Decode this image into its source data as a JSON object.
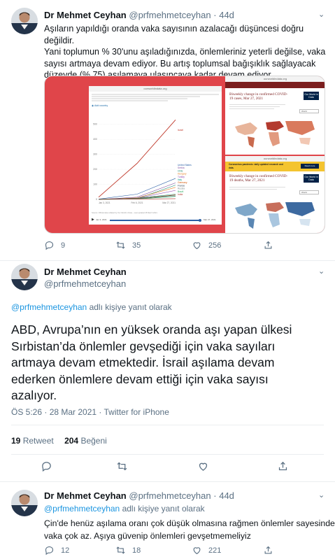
{
  "tweet1": {
    "name": "Dr Mehmet Ceyhan",
    "handle": "@prfmehmetceyhan",
    "dot": "·",
    "time": "44d",
    "lines": [
      "Aşıların yapıldığı oranda vaka sayısının azalacağı düşüncesi doğru değildir.",
      "Yani toplumun % 30'unu aşıladığınızda, önlemleriniz yeterli değilse, vaka",
      "sayısı artmaya devam ediyor. Bu artış toplumsal bağışıklık sağlayacak",
      "düzeyde (% 75) aşılamaya ulaşıncaya kadar devam ediyor."
    ],
    "replies": "9",
    "retweets": "35",
    "likes": "256"
  },
  "media": {
    "site": "ourworldindata.org",
    "add_country": "Add country",
    "chart_tag": "Israel",
    "countries": [
      "United States",
      "Serbia",
      "Turkey",
      "Chile",
      "Hungary",
      "Italy",
      "Germany",
      "France",
      "Russia",
      "Brazil",
      "India"
    ],
    "chart_ticks": [
      "500",
      "400",
      "300",
      "200",
      "100",
      "0"
    ],
    "x_ticks": [
      "Jan 3, 2021",
      "Feb 6, 2021",
      "Mar 27, 2021"
    ],
    "play_start": "Jan 3, 2021",
    "play_end": "Mar 27, 2021",
    "source_note": "Source: Official data collated by Our World in Data – Last updated 28 March 2021",
    "panel2_title": "Biweekly change in confirmed COVID-19 cases, Mar 27, 2021",
    "panel3_banner": "Coronavirus pandemic: daily updated research and data.",
    "panel3_button": "Read more",
    "panel3_title": "Biweekly change in confirmed COVID-19 deaths, Mar 27, 2021",
    "owid_logo": "Our World in Data",
    "select_world": "World"
  },
  "chart_data": {
    "type": "line",
    "title": "",
    "xlabel": "",
    "ylabel": "",
    "x": [
      "Jan 3, 2021",
      "Feb 6, 2021",
      "Mar 27, 2021"
    ],
    "ylim": [
      0,
      550
    ],
    "series": [
      {
        "name": "Israel",
        "values": [
          15,
          240,
          530
        ]
      },
      {
        "name": "United States",
        "values": [
          2,
          35,
          140
        ]
      },
      {
        "name": "Serbia",
        "values": [
          0,
          15,
          110
        ]
      },
      {
        "name": "Chile",
        "values": [
          0,
          5,
          95
        ]
      },
      {
        "name": "Hungary",
        "values": [
          0,
          10,
          80
        ]
      },
      {
        "name": "Turkey",
        "values": [
          0,
          8,
          60
        ]
      },
      {
        "name": "Italy",
        "values": [
          1,
          8,
          35
        ]
      },
      {
        "name": "Germany",
        "values": [
          1,
          6,
          30
        ]
      },
      {
        "name": "France",
        "values": [
          1,
          5,
          28
        ]
      },
      {
        "name": "Russia",
        "values": [
          0,
          4,
          22
        ]
      },
      {
        "name": "Brazil",
        "values": [
          0,
          2,
          20
        ]
      },
      {
        "name": "India",
        "values": [
          0,
          2,
          5
        ]
      }
    ]
  },
  "tweet2": {
    "name": "Dr Mehmet Ceyhan",
    "handle": "@prfmehmetceyhan",
    "reply_to_handle": "@prfmehmetceyhan",
    "reply_to_suffix": " adlı kişiye yanıt olarak",
    "lines": [
      "ABD, Avrupa’nın en yüksek oranda aşı yapan ülkesi",
      "Sırbistan’da önlemler gevşediği için vaka sayıları",
      "artmaya devam etmektedir. İsrail aşılama devam",
      "ederken önlemlere devam ettiği için vaka sayısı",
      "azalıyor."
    ],
    "timestamp": "ÖS 5:26 · 28 Mar 2021 · ",
    "source": "Twitter for iPhone",
    "retweet_count": "19",
    "retweet_label": "Retweet",
    "like_count": "204",
    "like_label": "Beğeni"
  },
  "tweet3": {
    "name": "Dr Mehmet Ceyhan",
    "handle": "@prfmehmetceyhan",
    "dot": "·",
    "time": "44d",
    "reply_to_handle": "@prfmehmetceyhan",
    "reply_to_suffix": " adlı kişiye yanıt olarak",
    "lines": [
      "Çin'de henüz aşılama oranı çok düşük olmasına rağmen önlemler sayesinde",
      "vaka çok az. Aşıya güvenip önlemleri gevşetmemeliyiz"
    ],
    "replies": "12",
    "retweets": "18",
    "likes": "221"
  }
}
